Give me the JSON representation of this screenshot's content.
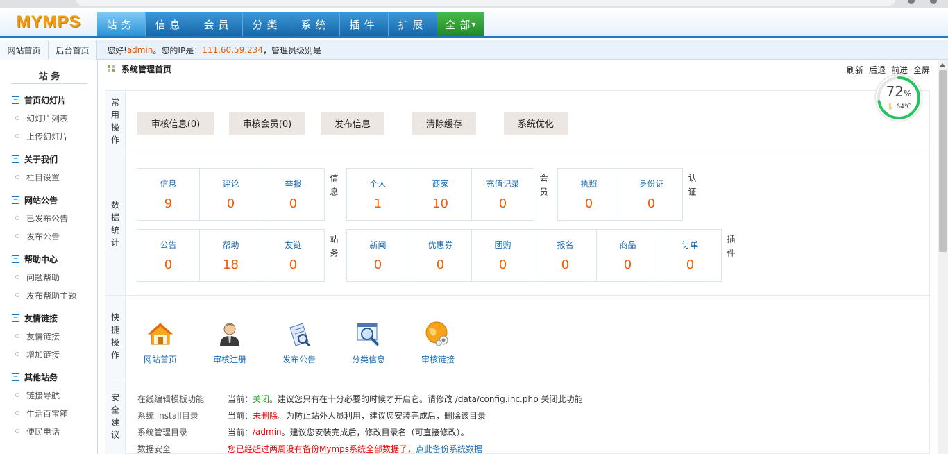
{
  "header": {
    "logo": "MYMPS",
    "nav": [
      {
        "label": "站务",
        "active": true
      },
      {
        "label": "信息"
      },
      {
        "label": "会员"
      },
      {
        "label": "分类"
      },
      {
        "label": "系统"
      },
      {
        "label": "插件"
      },
      {
        "label": "扩展"
      },
      {
        "label": "全部"
      }
    ]
  },
  "subbar": {
    "tab_site_home": "网站首页",
    "tab_admin_home": "后台首页",
    "greet_prefix": "您好!",
    "username": "admin",
    "ip_prefix": "。您的IP是：",
    "ip": "111.60.59.234",
    "role_text": "，管理员级别是"
  },
  "sidebar": {
    "title": "站 务",
    "groups": [
      {
        "title": "首页幻灯片",
        "items": [
          "幻灯片列表",
          "上传幻灯片"
        ]
      },
      {
        "title": "关于我们",
        "items": [
          "栏目设置"
        ]
      },
      {
        "title": "网站公告",
        "items": [
          "已发布公告",
          "发布公告"
        ]
      },
      {
        "title": "帮助中心",
        "items": [
          "问题帮助",
          "发布帮助主题"
        ]
      },
      {
        "title": "友情链接",
        "items": [
          "友情链接",
          "增加链接"
        ]
      },
      {
        "title": "其他站务",
        "items": [
          "链接导航",
          "生活百宝箱",
          "便民电话"
        ]
      }
    ]
  },
  "content": {
    "title": "系统管理首页",
    "toplinks": [
      "刷新",
      "后退",
      "前进",
      "全屏"
    ]
  },
  "gauge": {
    "percent": "72",
    "percent_unit": "%",
    "temp": "64℃"
  },
  "sections": {
    "common": {
      "label": "常用操作",
      "buttons": [
        "审核信息(0)",
        "审核会员(0)",
        "发布信息",
        "清除缓存",
        "系统优化"
      ]
    },
    "stats": {
      "label": "数据统计",
      "groups": [
        {
          "tag": "信息",
          "cells": [
            {
              "label": "信息",
              "value": "9"
            },
            {
              "label": "评论",
              "value": "0"
            },
            {
              "label": "举报",
              "value": "0"
            }
          ]
        },
        {
          "tag": "会员",
          "cells": [
            {
              "label": "个人",
              "value": "1"
            },
            {
              "label": "商家",
              "value": "10"
            },
            {
              "label": "充值记录",
              "value": "0"
            }
          ]
        },
        {
          "tag": "认证",
          "cells": [
            {
              "label": "执照",
              "value": "0"
            },
            {
              "label": "身份证",
              "value": "0"
            }
          ]
        },
        {
          "tag": "站务",
          "cells": [
            {
              "label": "公告",
              "value": "0"
            },
            {
              "label": "帮助",
              "value": "18"
            },
            {
              "label": "友链",
              "value": "0"
            }
          ]
        },
        {
          "tag": "插件",
          "cells": [
            {
              "label": "新闻",
              "value": "0"
            },
            {
              "label": "优惠券",
              "value": "0"
            },
            {
              "label": "团购",
              "value": "0"
            },
            {
              "label": "报名",
              "value": "0"
            },
            {
              "label": "商品",
              "value": "0"
            },
            {
              "label": "订单",
              "value": "0"
            }
          ]
        }
      ]
    },
    "quick": {
      "label": "快捷操作",
      "items": [
        {
          "label": "网站首页",
          "icon": "house-icon"
        },
        {
          "label": "审核注册",
          "icon": "user-icon"
        },
        {
          "label": "发布公告",
          "icon": "document-icon"
        },
        {
          "label": "分类信息",
          "icon": "magnifier-icon"
        },
        {
          "label": "审核链接",
          "icon": "link-globe-icon"
        }
      ]
    },
    "security": {
      "label": "安全建议",
      "rows": [
        {
          "key": "在线编辑模板功能",
          "pre": "当前：",
          "status": "关闭",
          "post": "。建议您只有在十分必要的时候才开启它。请修改 /data/config.inc.php 关闭此功能"
        },
        {
          "key": "系统 install目录",
          "pre": "当前：",
          "status": "未删除",
          "post": "。为防止站外人员利用，建议您安装完成后，删除该目录"
        },
        {
          "key": "系统管理目录",
          "pre": "当前：",
          "status": "/admin",
          "post": "。建议您安装完成后，修改目录名（可直接修改）。"
        },
        {
          "key": "数据安全",
          "warn": "您已经超过两周没有备份Mymps系统全部数据了，",
          "link": "点此备份系统数据"
        }
      ]
    }
  },
  "colors": {
    "nav_blue": "#1767a8",
    "nav_green": "#1f8a25",
    "accent_orange": "#f05a00",
    "link_blue": "#1c6bb0",
    "gauge_green": "#22c55e"
  }
}
